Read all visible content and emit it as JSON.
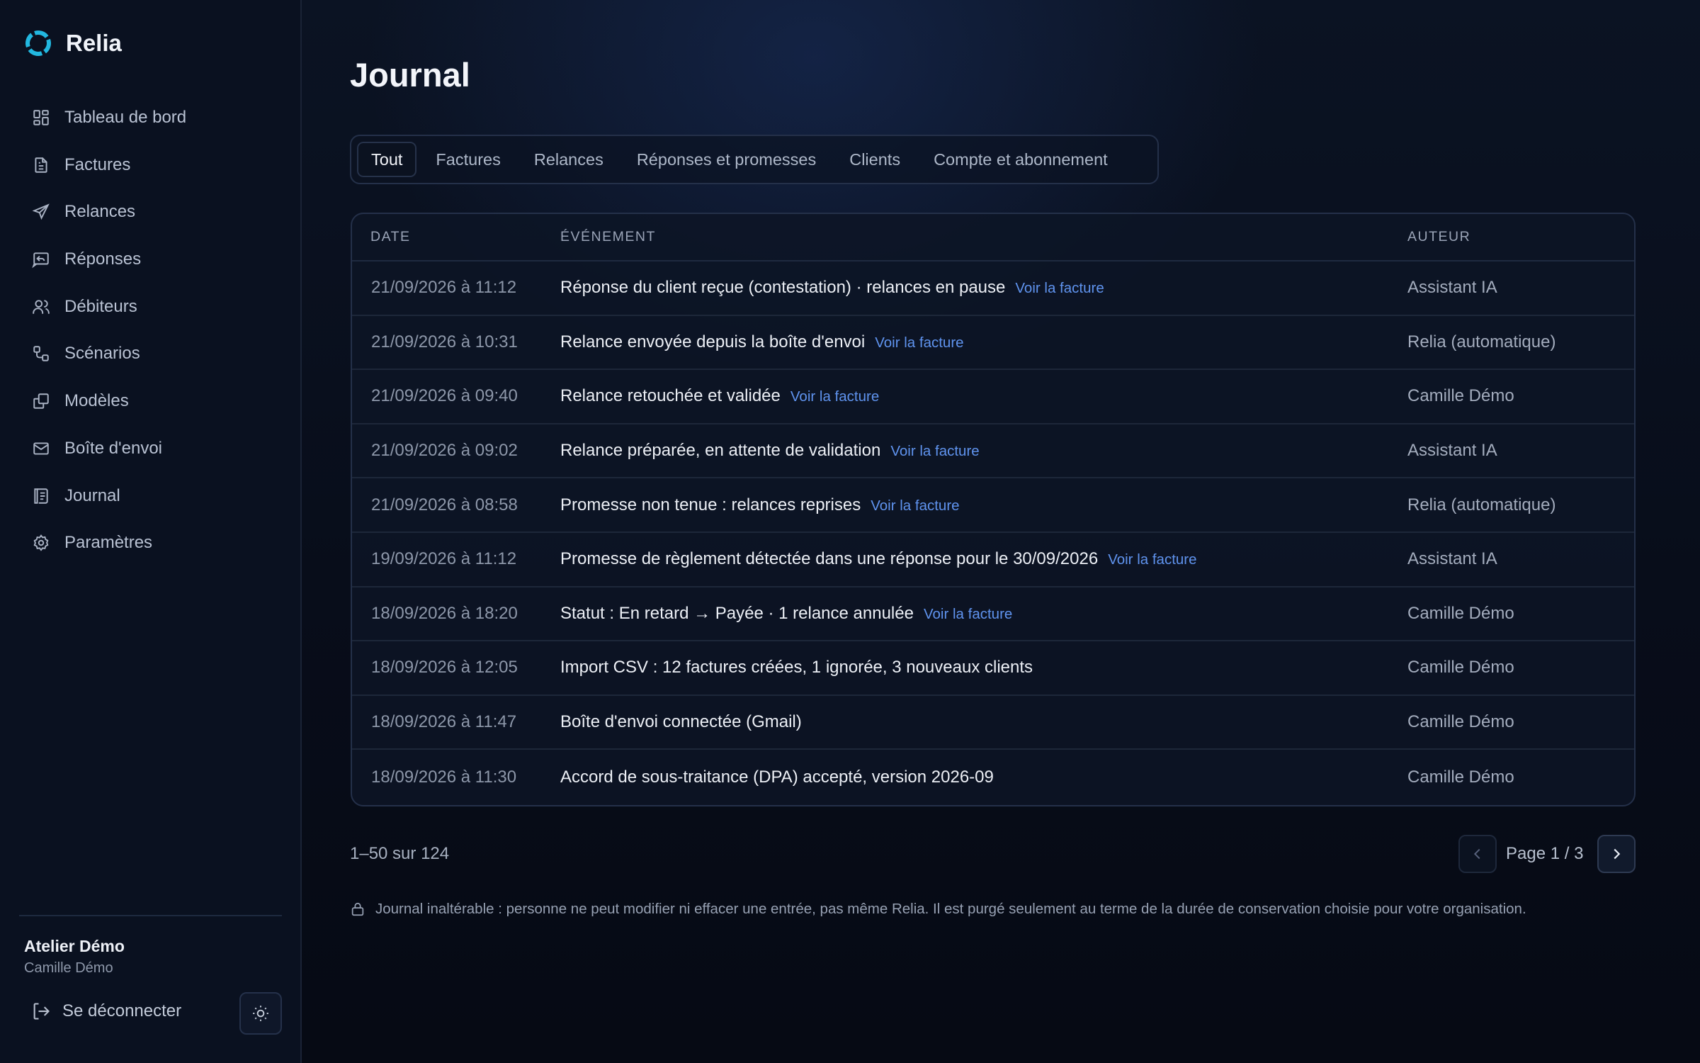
{
  "app": {
    "name": "Relia"
  },
  "sidebar": {
    "items": [
      {
        "label": "Tableau de bord",
        "icon": "dashboard-icon"
      },
      {
        "label": "Factures",
        "icon": "invoice-icon"
      },
      {
        "label": "Relances",
        "icon": "send-icon"
      },
      {
        "label": "Réponses",
        "icon": "reply-icon"
      },
      {
        "label": "Débiteurs",
        "icon": "users-icon"
      },
      {
        "label": "Scénarios",
        "icon": "workflow-icon"
      },
      {
        "label": "Modèles",
        "icon": "templates-icon"
      },
      {
        "label": "Boîte d'envoi",
        "icon": "mail-icon"
      },
      {
        "label": "Journal",
        "icon": "log-icon"
      },
      {
        "label": "Paramètres",
        "icon": "gear-icon"
      }
    ],
    "org": {
      "name": "Atelier Démo",
      "user": "Camille Démo"
    },
    "logout_label": "Se déconnecter",
    "theme_icon": "sun-icon"
  },
  "main": {
    "title": "Journal",
    "tabs": [
      {
        "label": "Tout",
        "active": true
      },
      {
        "label": "Factures"
      },
      {
        "label": "Relances"
      },
      {
        "label": "Réponses et promesses"
      },
      {
        "label": "Clients"
      },
      {
        "label": "Compte et abonnement"
      }
    ],
    "table": {
      "headers": {
        "date": "DATE",
        "event": "ÉVÉNEMENT",
        "author": "AUTEUR"
      },
      "link_label": "Voir la facture",
      "rows": [
        {
          "date": "21/09/2026 à 11:12",
          "event": "Réponse du client reçue (contestation) · relances en pause",
          "link": "Voir la facture",
          "author": "Assistant IA"
        },
        {
          "date": "21/09/2026 à 10:31",
          "event": "Relance envoyée depuis la boîte d'envoi",
          "link": "Voir la facture",
          "author": "Relia (automatique)"
        },
        {
          "date": "21/09/2026 à 09:40",
          "event": "Relance retouchée et validée",
          "link": "Voir la facture",
          "author": "Camille Démo"
        },
        {
          "date": "21/09/2026 à 09:02",
          "event": "Relance préparée, en attente de validation",
          "link": "Voir la facture",
          "author": "Assistant IA"
        },
        {
          "date": "21/09/2026 à 08:58",
          "event": "Promesse non tenue : relances reprises",
          "link": "Voir la facture",
          "author": "Relia (automatique)"
        },
        {
          "date": "19/09/2026 à 11:12",
          "event": "Promesse de règlement détectée dans une réponse pour le 30/09/2026",
          "link": "Voir la facture",
          "author": "Assistant IA"
        },
        {
          "date": "18/09/2026 à 18:20",
          "event": "Statut : En retard → Payée · 1 relance annulée",
          "link": "Voir la facture",
          "author": "Camille Démo"
        },
        {
          "date": "18/09/2026 à 12:05",
          "event": "Import CSV : 12 factures créées, 1 ignorée, 3 nouveaux clients",
          "link": "",
          "author": "Camille Démo"
        },
        {
          "date": "18/09/2026 à 11:47",
          "event": "Boîte d'envoi connectée (Gmail)",
          "link": "",
          "author": "Camille Démo"
        },
        {
          "date": "18/09/2026 à 11:30",
          "event": "Accord de sous-traitance (DPA) accepté, version 2026-09",
          "link": "",
          "author": "Camille Démo"
        }
      ]
    },
    "pagination": {
      "count": "1–50 sur 124",
      "page": "Page 1 / 3"
    },
    "notice": "Journal inaltérable : personne ne peut modifier ni effacer une entrée, pas même Relia. Il est purgé seulement au terme de la durée de conservation choisie pour votre organisation."
  },
  "colors": {
    "accent": "#5f93ee",
    "logo": "#22b8e0",
    "background": "#080d1a"
  }
}
